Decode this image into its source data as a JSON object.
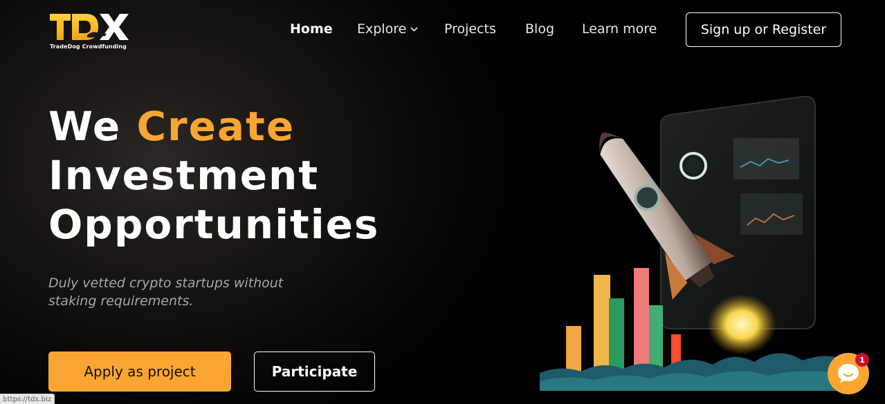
{
  "brand": {
    "logo_text": "TDX",
    "tagline": "TradeDog Crowdfunding",
    "accent_color": "#f9a532"
  },
  "nav": {
    "items": [
      {
        "label": "Home",
        "active": true
      },
      {
        "label": "Explore",
        "has_dropdown": true
      },
      {
        "label": "Projects"
      },
      {
        "label": "Blog"
      },
      {
        "label": "Learn more"
      }
    ],
    "signup_label": "Sign up or Register"
  },
  "hero": {
    "title_word1": "We",
    "title_accent": "Create",
    "title_line2": "Investment",
    "title_line3": "Opportunities",
    "subtitle": "Duly vetted crypto startups without staking requirements.",
    "primary_cta": "Apply as project",
    "secondary_cta": "Participate",
    "illustration": "rocket-launch-chart-illustration"
  },
  "chat": {
    "icon": "chat-bubble-icon",
    "badge_count": "1",
    "badge_color": "#c8102e"
  },
  "status_bar": {
    "url": "https://tdx.biz"
  }
}
